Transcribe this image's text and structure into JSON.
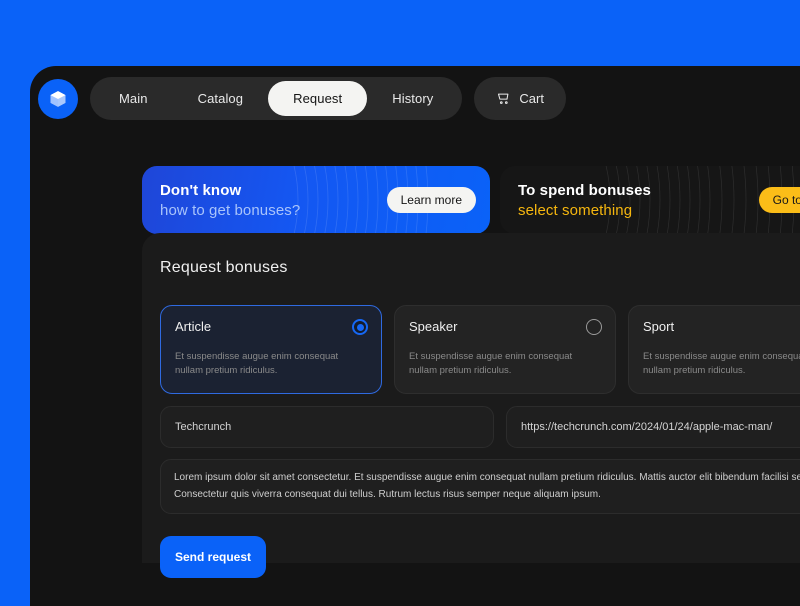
{
  "theme": {
    "page_background": "#0a62f8",
    "window_background": "#131313",
    "panel_background": "#1b1b1b",
    "accent_blue": "#0a62f8",
    "accent_yellow": "#fbbd18",
    "text_primary": "#efefef",
    "text_muted": "#8a8a8a"
  },
  "nav": {
    "logo_icon": "cube-icon",
    "tabs": [
      {
        "label": "Main",
        "active": false
      },
      {
        "label": "Catalog",
        "active": false
      },
      {
        "label": "Request",
        "active": true
      },
      {
        "label": "History",
        "active": false
      }
    ],
    "cart": {
      "label": "Cart",
      "icon": "shopping-cart-icon"
    }
  },
  "banners": [
    {
      "line1": "Don't know",
      "line2": "how to get bonuses?",
      "button": "Learn more"
    },
    {
      "line1": "To spend bonuses",
      "line2": "select something",
      "button": "Go to catalog"
    }
  ],
  "main": {
    "section_title": "Request bonuses",
    "options": [
      {
        "title": "Article",
        "description": "Et suspendisse augue enim consequat nullam pretium ridiculus.",
        "selected": true
      },
      {
        "title": "Speaker",
        "description": "Et suspendisse augue enim consequat nullam pretium ridiculus.",
        "selected": false
      },
      {
        "title": "Sport",
        "description": "Et suspendisse augue enim consequat nullam pretium ridiculus.",
        "selected": false
      }
    ],
    "source_field": {
      "value": "Techcrunch"
    },
    "url_field": {
      "value": "https://techcrunch.com/2024/01/24/apple-mac-man/"
    },
    "description_field": {
      "value": "Lorem ipsum dolor sit amet consectetur. Et suspendisse augue enim consequat nullam pretium ridiculus. Mattis auctor elit bibendum facilisi sed molestie. Consectetur quis viverra consequat dui tellus. Rutrum lectus risus semper neque aliquam ipsum."
    },
    "submit_button": "Send request"
  }
}
